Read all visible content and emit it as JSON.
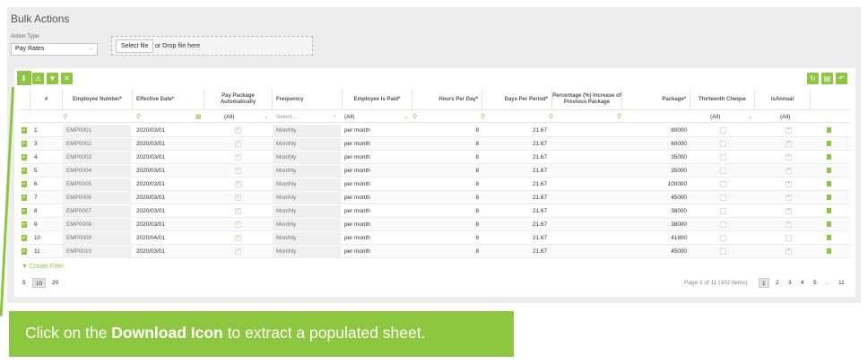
{
  "page": {
    "title": "Bulk Actions"
  },
  "action_type": {
    "label": "Action Type:",
    "value": "Pay Rates"
  },
  "upload": {
    "button_label": "Select file",
    "hint": "or Drop file here"
  },
  "toolbar": {
    "left": [
      {
        "icon": "download-icon"
      },
      {
        "icon": "upload-warning-icon"
      },
      {
        "icon": "filter-icon"
      },
      {
        "icon": "clear-filter-icon"
      }
    ],
    "right": [
      {
        "icon": "refresh-icon"
      },
      {
        "icon": "column-chooser-icon"
      },
      {
        "icon": "undo-icon"
      }
    ]
  },
  "grid": {
    "columns": [
      "#",
      "Employee Number*",
      "Effective Date*",
      "Pay Package Automatically",
      "Frequency",
      "Employee Is Paid*",
      "Hours Per Day*",
      "Days Per Period*",
      "Percentage (%) Increase of Previous Package",
      "Package*",
      "Thirteenth Cheque",
      "IsAnnual"
    ],
    "filters": {
      "pay_package": "(All)",
      "frequency": "Select...",
      "employee_is_paid": "(All)",
      "thirteenth": "(All)",
      "is_annual": "(All)"
    },
    "rows": [
      {
        "n": "1",
        "emp": "EMP0001",
        "date": "2020/03/01",
        "pp": true,
        "freq": "Monthly",
        "paid": "per month",
        "hours": "8",
        "days": "21.67",
        "pct": "",
        "pkg": "80000",
        "thirteenth": false,
        "annual": true
      },
      {
        "n": "3",
        "emp": "EMP0002",
        "date": "2020/03/01",
        "pp": true,
        "freq": "Monthly",
        "paid": "per month",
        "hours": "8",
        "days": "21.67",
        "pct": "",
        "pkg": "60000",
        "thirteenth": false,
        "annual": true
      },
      {
        "n": "4",
        "emp": "EMP0003",
        "date": "2020/03/01",
        "pp": true,
        "freq": "Monthly",
        "paid": "per month",
        "hours": "8",
        "days": "21.67",
        "pct": "",
        "pkg": "35000",
        "thirteenth": false,
        "annual": true
      },
      {
        "n": "5",
        "emp": "EMP0004",
        "date": "2020/03/01",
        "pp": true,
        "freq": "Monthly",
        "paid": "per month",
        "hours": "8",
        "days": "21.67",
        "pct": "",
        "pkg": "35000",
        "thirteenth": false,
        "annual": true
      },
      {
        "n": "6",
        "emp": "EMP0005",
        "date": "2020/03/01",
        "pp": true,
        "freq": "Monthly",
        "paid": "per month",
        "hours": "8",
        "days": "21.67",
        "pct": "",
        "pkg": "100000",
        "thirteenth": false,
        "annual": true
      },
      {
        "n": "7",
        "emp": "EMP0006",
        "date": "2020/03/01",
        "pp": true,
        "freq": "Monthly",
        "paid": "per month",
        "hours": "8",
        "days": "21.67",
        "pct": "",
        "pkg": "45000",
        "thirteenth": false,
        "annual": true
      },
      {
        "n": "8",
        "emp": "EMP0007",
        "date": "2020/03/01",
        "pp": true,
        "freq": "Monthly",
        "paid": "per month",
        "hours": "8",
        "days": "21.67",
        "pct": "",
        "pkg": "38000",
        "thirteenth": false,
        "annual": true
      },
      {
        "n": "9",
        "emp": "EMP0008",
        "date": "2020/03/01",
        "pp": true,
        "freq": "Monthly",
        "paid": "per month",
        "hours": "8",
        "days": "21.67",
        "pct": "",
        "pkg": "38000",
        "thirteenth": false,
        "annual": true
      },
      {
        "n": "10",
        "emp": "EMP0009",
        "date": "2020/04/01",
        "pp": true,
        "freq": "Monthly",
        "paid": "per month",
        "hours": "8",
        "days": "21.67",
        "pct": "",
        "pkg": "41800",
        "thirteenth": false,
        "annual": false
      },
      {
        "n": "11",
        "emp": "EMP0010",
        "date": "2020/03/01",
        "pp": true,
        "freq": "Monthly",
        "paid": "per month",
        "hours": "8",
        "days": "21.67",
        "pct": "",
        "pkg": "45000",
        "thirteenth": false,
        "annual": true
      }
    ],
    "create_filter": "Create Filter"
  },
  "pager": {
    "sizes": [
      "5",
      "10",
      "20"
    ],
    "active_size": "10",
    "info": "Page 1 of 11 (102 items)",
    "pages": [
      "1",
      "2",
      "3",
      "4",
      "5",
      "...",
      "11"
    ],
    "active_page": "1"
  },
  "callout": {
    "prefix": "Click on the ",
    "bold": "Download Icon",
    "suffix": " to extract a populated sheet."
  },
  "colors": {
    "accent": "#8dc63f",
    "shell": "#ededed"
  }
}
